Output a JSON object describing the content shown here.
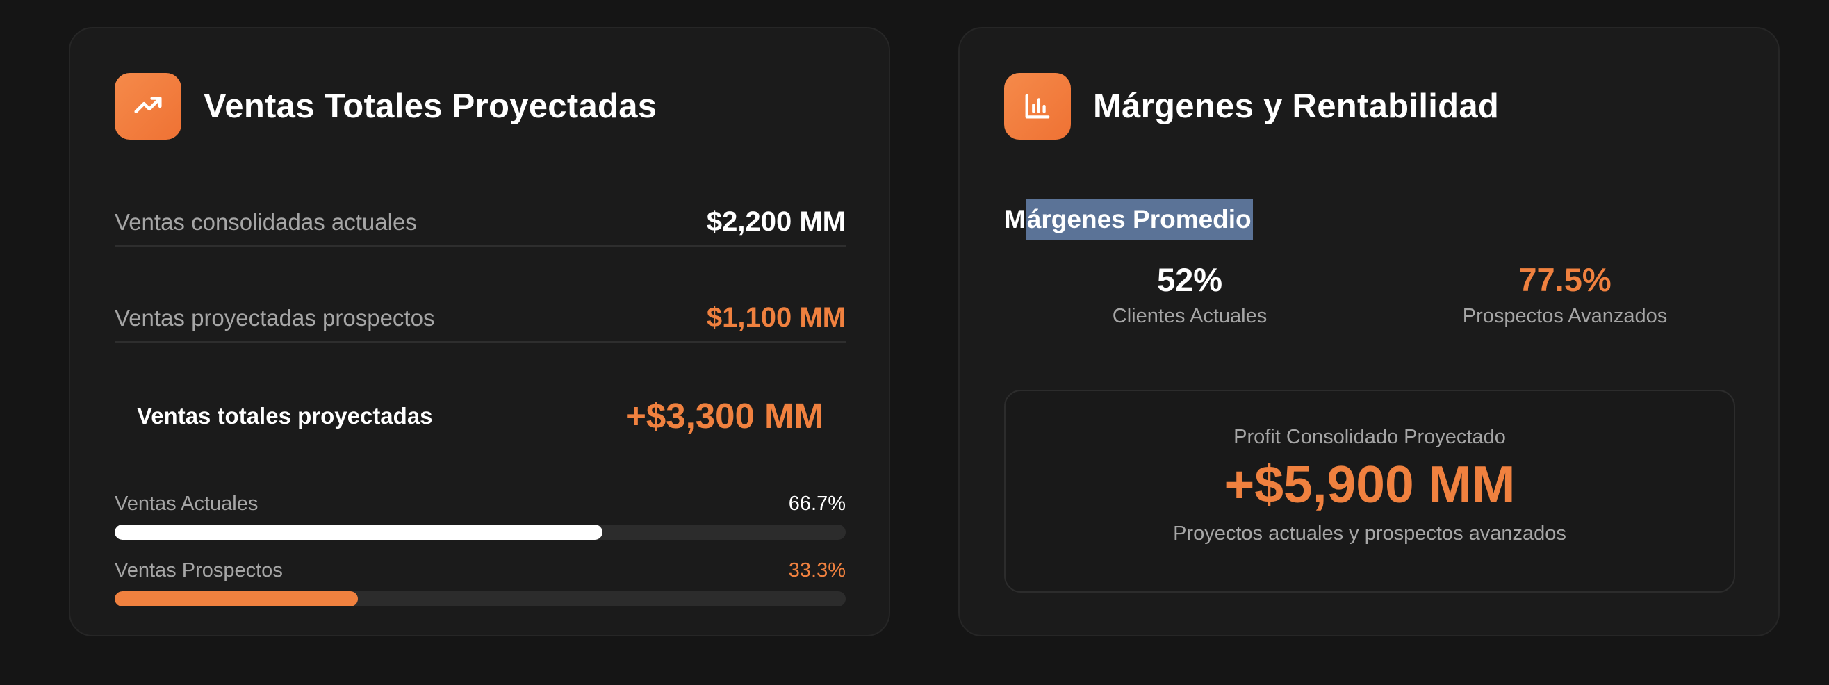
{
  "colors": {
    "accent": "#f0813f",
    "background": "#151515",
    "card": "#1b1b1b",
    "selection": "#5b7397"
  },
  "ventas_card": {
    "icon": "trending-up-icon",
    "title": "Ventas Totales Proyectadas",
    "rows": [
      {
        "label": "Ventas consolidadas actuales",
        "value": "$2,200 MM"
      },
      {
        "label": "Ventas proyectadas prospectos",
        "value": "$1,100 MM"
      }
    ],
    "total": {
      "label": "Ventas totales proyectadas",
      "value": "+$3,300 MM"
    },
    "bars": [
      {
        "label": "Ventas Actuales",
        "percent_text": "66.7%",
        "percent": 66.7
      },
      {
        "label": "Ventas Prospectos",
        "percent_text": "33.3%",
        "percent": 33.3
      }
    ]
  },
  "margenes_card": {
    "icon": "bar-chart-icon",
    "title": "Márgenes y Rentabilidad",
    "subheading_first": "M",
    "subheading_selected": "árgenes Promedio",
    "metrics": [
      {
        "value": "52%",
        "label": "Clientes Actuales"
      },
      {
        "value": "77.5%",
        "label": "Prospectos Avanzados"
      }
    ],
    "profit": {
      "title": "Profit Consolidado Proyectado",
      "value": "+$5,900 MM",
      "subtitle": "Proyectos actuales y prospectos avanzados"
    }
  }
}
